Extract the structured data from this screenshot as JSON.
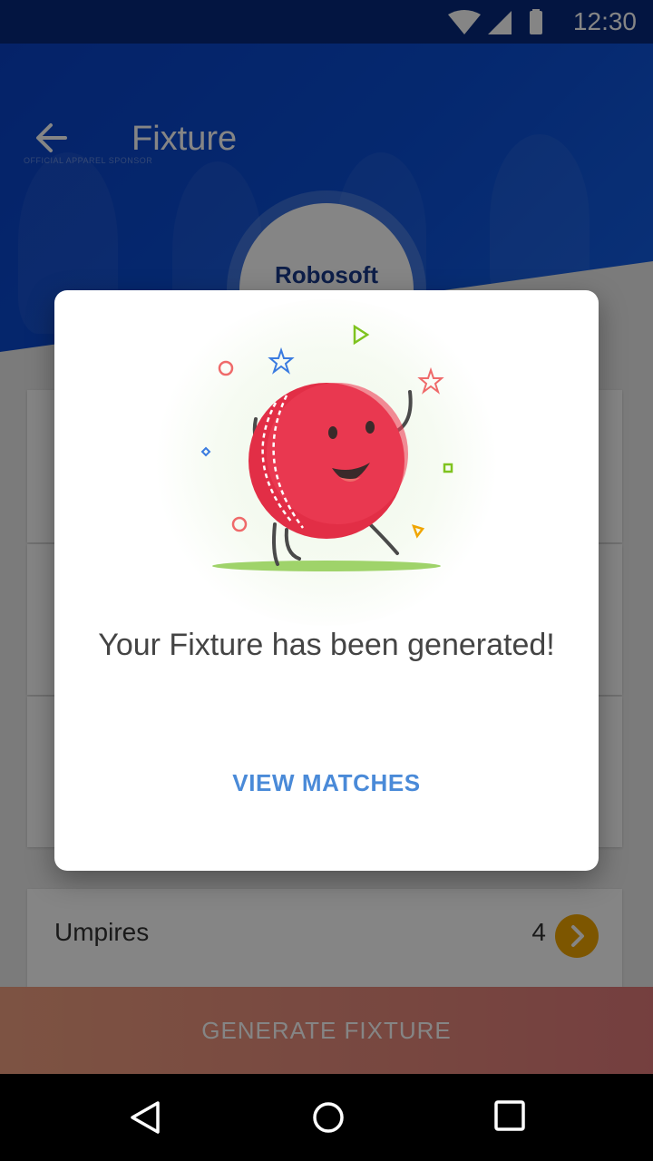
{
  "status_bar": {
    "time": "12:30",
    "icons": [
      "wifi-icon",
      "signal-icon",
      "battery-icon"
    ]
  },
  "header": {
    "title": "Fixture",
    "brand_text": "OFFICIAL APPAREL SPONSOR",
    "badge_text": "Robosoft Premiere"
  },
  "list": {
    "umpires_label": "Umpires",
    "umpires_count": "4"
  },
  "generate_button": {
    "label": "GENERATE FIXTURE"
  },
  "dialog": {
    "message": "Your Fixture has been generated!",
    "action_label": "VIEW MATCHES"
  },
  "colors": {
    "header_blue": "#0b4fd6",
    "accent_blue": "#4a8ad8",
    "ball_red": "#e22e46",
    "chevron_orange": "#f0a500"
  }
}
